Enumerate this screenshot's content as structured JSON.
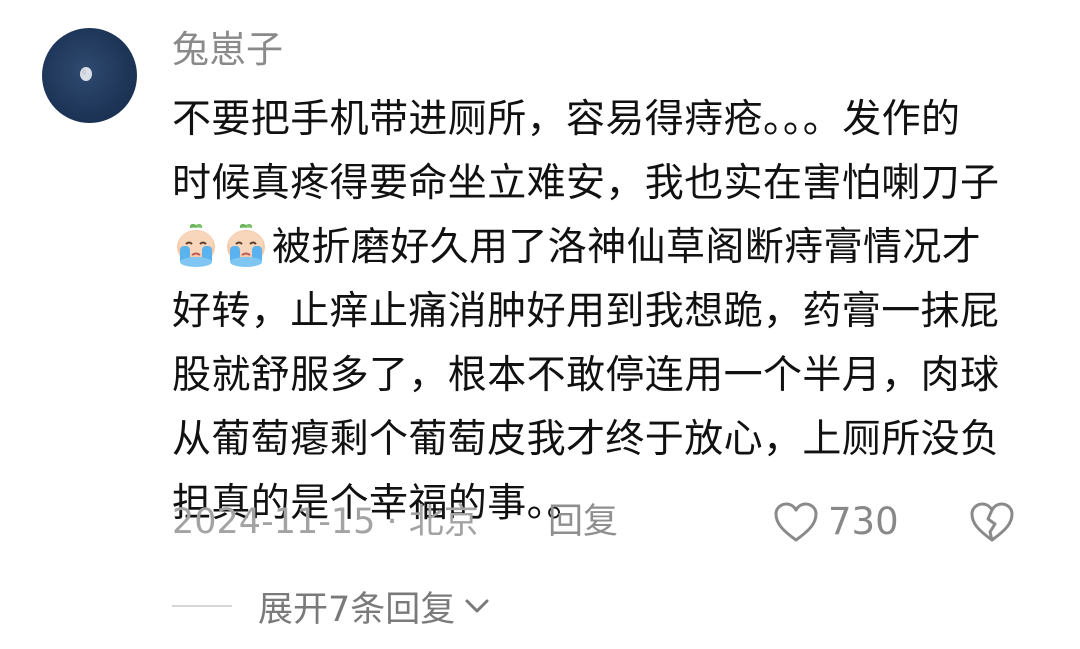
{
  "comment": {
    "username": "兔崽子",
    "lines_before_emoji": [
      "不要把手机带进厕所，容易得痔疮。。。发作的",
      "时候真疼得要命坐立难安，我也实在害怕喇刀子"
    ],
    "emoji_line_text": "被折磨好久用了洛神仙草阁断痔膏情况才",
    "lines_after_emoji": [
      "好转，止痒止痛消肿好用到我想跪，药膏一抹屁",
      "股就舒服多了，根本不敢停连用一个半月，肉球",
      "从葡萄瘪剩个葡萄皮我才终于放心，上厕所没负",
      "担真的是个幸福的事。。"
    ],
    "emojis": [
      "crying-face-emoji",
      "crying-face-emoji"
    ]
  },
  "meta": {
    "date_location": "2024-11-15 · 北京",
    "reply_label": "回复",
    "like_count": "730"
  },
  "expand": {
    "label": "展开7条回复"
  },
  "colors": {
    "username": "#8a8a8a",
    "meta": "#a3a3a3",
    "avatar_bg": "#1d3557"
  }
}
